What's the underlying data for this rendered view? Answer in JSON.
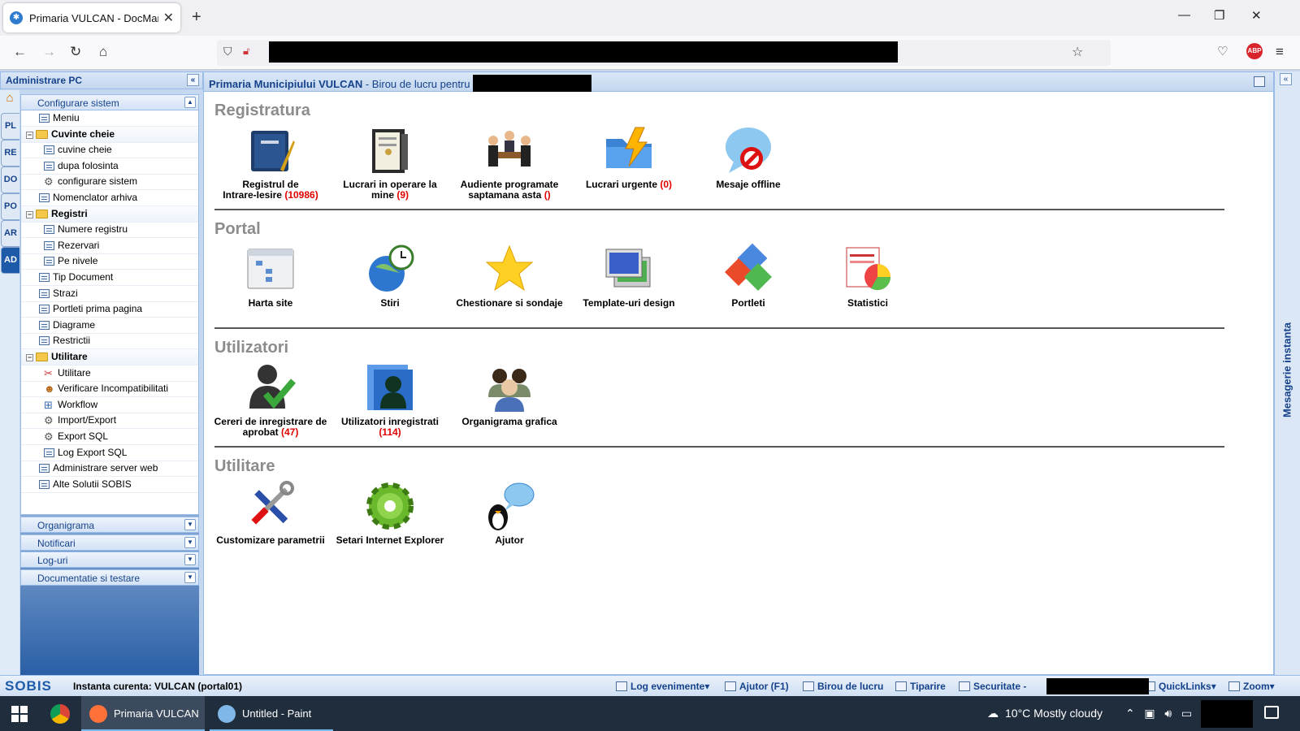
{
  "browser": {
    "tab_title": "Primaria VULCAN - DocManage",
    "tab_close": "✕",
    "new_tab": "+",
    "win_min": "—",
    "win_max": "❐",
    "win_close": "✕",
    "abp_label": "ABP"
  },
  "sidebar": {
    "title": "Administrare PC",
    "collapse": "«",
    "vtabs": [
      "PL",
      "RE",
      "DO",
      "PO",
      "AR",
      "AD"
    ],
    "active_vtab": "AD",
    "accordion_open": "Configurare sistem",
    "tree": [
      {
        "label": "Meniu",
        "type": "item",
        "indent": 1,
        "icon": "list"
      },
      {
        "label": "Cuvinte cheie",
        "type": "group",
        "indent": 0
      },
      {
        "label": "cuvine cheie",
        "type": "item",
        "indent": 2,
        "icon": "list"
      },
      {
        "label": "dupa folosinta",
        "type": "item",
        "indent": 2,
        "icon": "list"
      },
      {
        "label": "configurare sistem",
        "type": "item",
        "indent": 2,
        "icon": "gear"
      },
      {
        "label": "Nomenclator arhiva",
        "type": "item",
        "indent": 1,
        "icon": "list"
      },
      {
        "label": "Registri",
        "type": "group",
        "indent": 0
      },
      {
        "label": "Numere registru",
        "type": "item",
        "indent": 2,
        "icon": "list"
      },
      {
        "label": "Rezervari",
        "type": "item",
        "indent": 2,
        "icon": "list"
      },
      {
        "label": "Pe nivele",
        "type": "item",
        "indent": 2,
        "icon": "list"
      },
      {
        "label": "Tip Document",
        "type": "item",
        "indent": 1,
        "icon": "list"
      },
      {
        "label": "Strazi",
        "type": "item",
        "indent": 1,
        "icon": "list"
      },
      {
        "label": "Portleti prima pagina",
        "type": "item",
        "indent": 1,
        "icon": "list"
      },
      {
        "label": "Diagrame",
        "type": "item",
        "indent": 1,
        "icon": "list"
      },
      {
        "label": "Restrictii",
        "type": "item",
        "indent": 1,
        "icon": "list"
      },
      {
        "label": "Utilitare",
        "type": "group",
        "indent": 0
      },
      {
        "label": "Utilitare",
        "type": "item",
        "indent": 2,
        "icon": "tools"
      },
      {
        "label": "Verificare Incompatibilitati",
        "type": "item",
        "indent": 2,
        "icon": "user"
      },
      {
        "label": "Workflow",
        "type": "item",
        "indent": 2,
        "icon": "flow"
      },
      {
        "label": "Import/Export",
        "type": "item",
        "indent": 2,
        "icon": "gear"
      },
      {
        "label": "Export SQL",
        "type": "item",
        "indent": 2,
        "icon": "gear"
      },
      {
        "label": "Log Export SQL",
        "type": "item",
        "indent": 2,
        "icon": "list"
      },
      {
        "label": "Administrare server web",
        "type": "item",
        "indent": 1,
        "icon": "list"
      },
      {
        "label": "Alte Solutii SOBIS",
        "type": "item",
        "indent": 1,
        "icon": "list"
      }
    ],
    "accordion_closed": [
      "Organigrama",
      "Notificari",
      "Log-uri",
      "Documentatie si testare"
    ]
  },
  "main": {
    "header_bold": "Primaria Municipiului VULCAN",
    "header_rest": " - Birou de lucru pentru",
    "sections": [
      {
        "title": "Registratura",
        "tiles": [
          {
            "l1": "Registrul de",
            "l2": "Intrare-Iesire",
            "count": "(10986)",
            "icon": "ledger-icon"
          },
          {
            "l1": "Lucrari in operare la",
            "l2": "mine",
            "count": "(9)",
            "icon": "binder-icon"
          },
          {
            "l1": "Audiente programate",
            "l2": "saptamana asta",
            "count": "()",
            "icon": "meeting-icon"
          },
          {
            "l1": "Lucrari urgente",
            "l2": "",
            "count": "(0)",
            "icon": "urgent-folder-icon"
          },
          {
            "l1": "Mesaje offline",
            "l2": "",
            "count": "",
            "icon": "offline-message-icon"
          }
        ]
      },
      {
        "title": "Portal",
        "tiles": [
          {
            "l1": "Harta site",
            "l2": "",
            "count": "",
            "icon": "sitemap-icon"
          },
          {
            "l1": "Stiri",
            "l2": "",
            "count": "",
            "icon": "globe-clock-icon"
          },
          {
            "l1": "Chestionare si sondaje",
            "l2": "",
            "count": "",
            "icon": "star-icon"
          },
          {
            "l1": "Template-uri design",
            "l2": "",
            "count": "",
            "icon": "template-icon"
          },
          {
            "l1": "Portleti",
            "l2": "",
            "count": "",
            "icon": "portlets-icon"
          },
          {
            "l1": "Statistici",
            "l2": "",
            "count": "",
            "icon": "statistics-icon"
          }
        ]
      },
      {
        "title": "Utilizatori",
        "tiles": [
          {
            "l1": "Cereri de inregistrare de",
            "l2": "aprobat",
            "count": "(47)",
            "icon": "user-approve-icon"
          },
          {
            "l1": "Utilizatori inregistrati",
            "l2": "",
            "count": "(114)",
            "icon": "registered-users-icon"
          },
          {
            "l1": "Organigrama grafica",
            "l2": "",
            "count": "",
            "icon": "org-chart-icon"
          }
        ]
      },
      {
        "title": "Utilitare",
        "tiles": [
          {
            "l1": "Customizare parametrii",
            "l2": "",
            "count": "",
            "icon": "tools-icon"
          },
          {
            "l1": "Setari Internet Explorer",
            "l2": "",
            "count": "",
            "icon": "settings-gear-icon"
          },
          {
            "l1": "Ajutor",
            "l2": "",
            "count": "",
            "icon": "help-penguin-icon"
          }
        ]
      }
    ]
  },
  "right_panel": {
    "label": "Mesagerie instanta",
    "collapse": "«"
  },
  "statusbar": {
    "brand": "SOBIS",
    "instance": "Instanta curenta: VULCAN (portal01)",
    "items": [
      {
        "label": "Log evenimente▾"
      },
      {
        "label": "Ajutor (F1)"
      },
      {
        "label": "Birou de lucru"
      },
      {
        "label": "Tiparire"
      },
      {
        "label": "Securitate -"
      },
      {
        "label": "QuickLinks▾"
      },
      {
        "label": "Zoom▾"
      }
    ]
  },
  "taskbar": {
    "apps": [
      {
        "label": "Primaria VULCAN -..."
      },
      {
        "label": "Untitled - Paint"
      }
    ],
    "weather": "10°C  Mostly cloudy"
  },
  "colors": {
    "accent": "#15428b",
    "count_red": "#e00000",
    "section_gray": "#8c8c8c"
  }
}
